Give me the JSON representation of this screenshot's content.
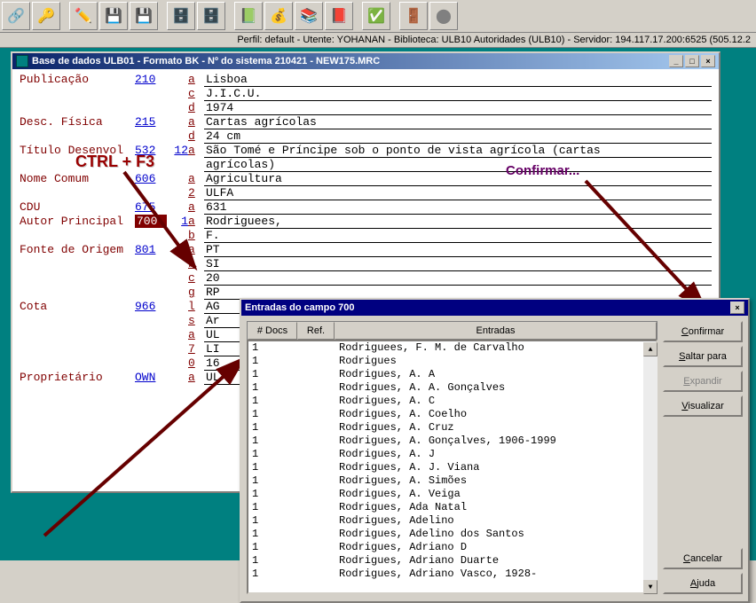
{
  "status_line": "Perfil: default - Utente: YOHANAN - Biblioteca: ULB10 Autoridades (ULB10) - Servidor: 194.117.17.200:6525 (505.12.2",
  "mdi_title": "Base de dados ULB01 - Formato BK - Nº do sistema 210421 - NEW175.MRC",
  "annotation_ctrl": "CTRL + F3",
  "annotation_conf": "Confirmar...",
  "fields": [
    {
      "label": "Publicação",
      "code": "210",
      "sub": "",
      "ind": "a",
      "val": "Lisboa"
    },
    {
      "label": "",
      "code": "",
      "sub": "",
      "ind": "c",
      "val": "J.I.C.U."
    },
    {
      "label": "",
      "code": "",
      "sub": "",
      "ind": "d",
      "val": "1974"
    },
    {
      "label": "Desc. Física",
      "code": "215",
      "sub": "",
      "ind": "a",
      "val": "Cartas agrícolas"
    },
    {
      "label": "",
      "code": "",
      "sub": "",
      "ind": "d",
      "val": "24 cm"
    },
    {
      "label": "Título Desenvol",
      "code": "532",
      "sub": "12",
      "ind": "a",
      "val": "São Tomé e Príncipe sob o ponto de vista agrícola (cartas"
    },
    {
      "label": "",
      "code": "",
      "sub": "",
      "ind": "",
      "val": "agrícolas)"
    },
    {
      "label": "Nome Comum",
      "code": "606",
      "sub": "",
      "ind": "a",
      "val": "Agricultura"
    },
    {
      "label": "",
      "code": "",
      "sub": "",
      "ind": "2",
      "val": "ULFA"
    },
    {
      "label": "CDU",
      "code": "675",
      "sub": "",
      "ind": "a",
      "val": "631"
    },
    {
      "label": "Autor Principal",
      "code": "700",
      "sub": "1",
      "ind": "a",
      "val": "Rodriguees,",
      "hl": true
    },
    {
      "label": "",
      "code": "",
      "sub": "",
      "ind": "b",
      "val": "F."
    },
    {
      "label": "Fonte de Origem",
      "code": "801",
      "sub": "0",
      "ind": "a",
      "val": "PT"
    },
    {
      "label": "",
      "code": "",
      "sub": "",
      "ind": "b",
      "val": "SI"
    },
    {
      "label": "",
      "code": "",
      "sub": "",
      "ind": "c",
      "val": "20"
    },
    {
      "label": "",
      "code": "",
      "sub": "",
      "ind": "g",
      "val": "RP"
    },
    {
      "label": "Cota",
      "code": "966",
      "sub": "",
      "ind": "l",
      "val": "AG"
    },
    {
      "label": "",
      "code": "",
      "sub": "",
      "ind": "s",
      "val": "Ar"
    },
    {
      "label": "",
      "code": "",
      "sub": "",
      "ind": "a",
      "val": "UL"
    },
    {
      "label": "",
      "code": "",
      "sub": "",
      "ind": "7",
      "val": "LI"
    },
    {
      "label": "",
      "code": "",
      "sub": "",
      "ind": "0",
      "val": "16"
    },
    {
      "label": "Proprietário",
      "code": "OWN",
      "sub": "",
      "ind": "a",
      "val": "UL"
    }
  ],
  "dialog": {
    "title": "Entradas do campo 700",
    "cols": {
      "docs": "# Docs",
      "ref": "Ref.",
      "ent": "Entradas"
    },
    "rows": [
      {
        "d": "1",
        "e": "Rodriguees, F. M. de Carvalho"
      },
      {
        "d": "1",
        "e": "Rodrigues"
      },
      {
        "d": "1",
        "e": "Rodrigues, A. A"
      },
      {
        "d": "1",
        "e": "Rodrigues, A. A. Gonçalves"
      },
      {
        "d": "1",
        "e": "Rodrigues, A. C"
      },
      {
        "d": "1",
        "e": "Rodrigues, A. Coelho"
      },
      {
        "d": "1",
        "e": "Rodrigues, A. Cruz"
      },
      {
        "d": "1",
        "e": "Rodrigues, A. Gonçalves, 1906-1999"
      },
      {
        "d": "1",
        "e": "Rodrigues, A. J"
      },
      {
        "d": "1",
        "e": "Rodrigues, A. J. Viana"
      },
      {
        "d": "1",
        "e": "Rodrigues, A. Simões"
      },
      {
        "d": "1",
        "e": "Rodrigues, A. Veiga"
      },
      {
        "d": "1",
        "e": "Rodrigues, Ada Natal"
      },
      {
        "d": "1",
        "e": "Rodrigues, Adelino"
      },
      {
        "d": "1",
        "e": "Rodrigues, Adelino dos Santos"
      },
      {
        "d": "1",
        "e": "Rodrigues, Adriano D"
      },
      {
        "d": "1",
        "e": "Rodrigues, Adriano Duarte"
      },
      {
        "d": "1",
        "e": "Rodrigues, Adriano Vasco, 1928-"
      }
    ],
    "buttons": {
      "confirmar": "Confirmar",
      "saltar": "Saltar para",
      "expandir": "Expandir",
      "visualizar": "Visualizar",
      "cancelar": "Cancelar",
      "ajuda": "Ajuda"
    }
  }
}
